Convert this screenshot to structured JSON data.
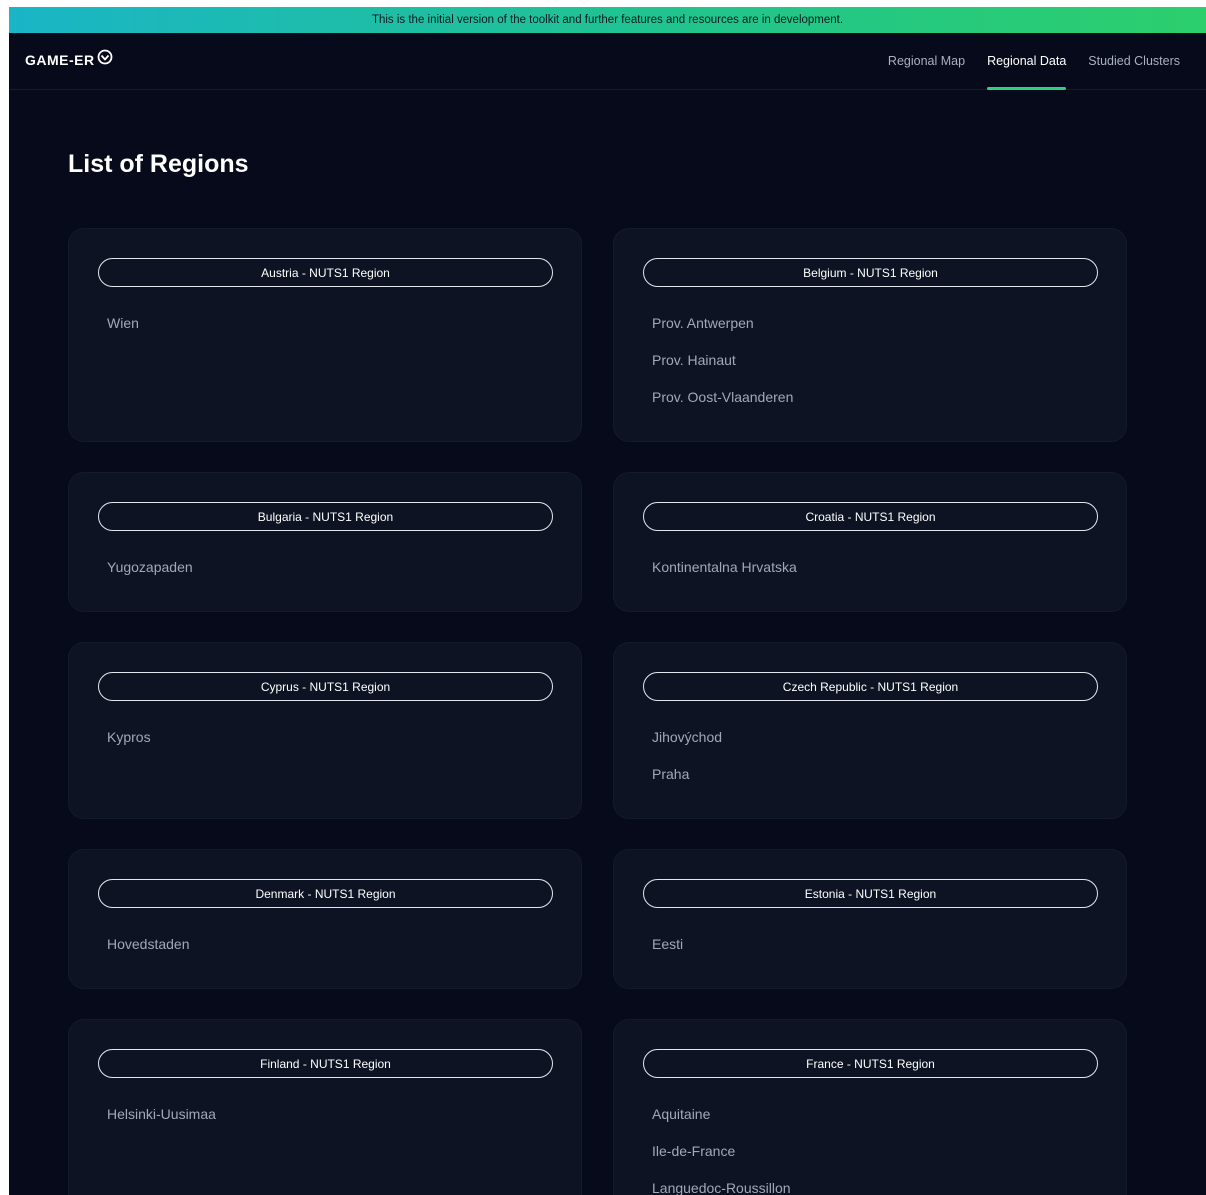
{
  "banner": {
    "text": "This is the initial version of the toolkit and further features and resources are in development."
  },
  "header": {
    "logo": "GAME-ER",
    "nav": [
      {
        "label": "Regional Map"
      },
      {
        "label": "Regional Data"
      },
      {
        "label": "Studied Clusters"
      }
    ],
    "active_nav": "Regional Data"
  },
  "main": {
    "title": "List of Regions",
    "countries": [
      {
        "label": "Austria - NUTS1 Region",
        "regions": [
          "Wien"
        ]
      },
      {
        "label": "Belgium - NUTS1 Region",
        "regions": [
          "Prov. Antwerpen",
          "Prov. Hainaut",
          "Prov. Oost-Vlaanderen"
        ]
      },
      {
        "label": "Bulgaria - NUTS1 Region",
        "regions": [
          "Yugozapaden"
        ]
      },
      {
        "label": "Croatia - NUTS1 Region",
        "regions": [
          "Kontinentalna Hrvatska"
        ]
      },
      {
        "label": "Cyprus - NUTS1 Region",
        "regions": [
          "Kypros"
        ]
      },
      {
        "label": "Czech Republic - NUTS1 Region",
        "regions": [
          "Jihovýchod",
          "Praha"
        ]
      },
      {
        "label": "Denmark - NUTS1 Region",
        "regions": [
          "Hovedstaden"
        ]
      },
      {
        "label": "Estonia - NUTS1 Region",
        "regions": [
          "Eesti"
        ]
      },
      {
        "label": "Finland - NUTS1 Region",
        "regions": [
          "Helsinki-Uusimaa"
        ]
      },
      {
        "label": "France - NUTS1 Region",
        "regions": [
          "Aquitaine",
          "Ile-de-France",
          "Languedoc-Roussillon"
        ]
      }
    ]
  },
  "colors": {
    "background": "#060a1a",
    "card": "#0d1322",
    "accent": "#2fd07b",
    "banner_start": "#1ab5c6",
    "banner_end": "#2ccf6c"
  }
}
